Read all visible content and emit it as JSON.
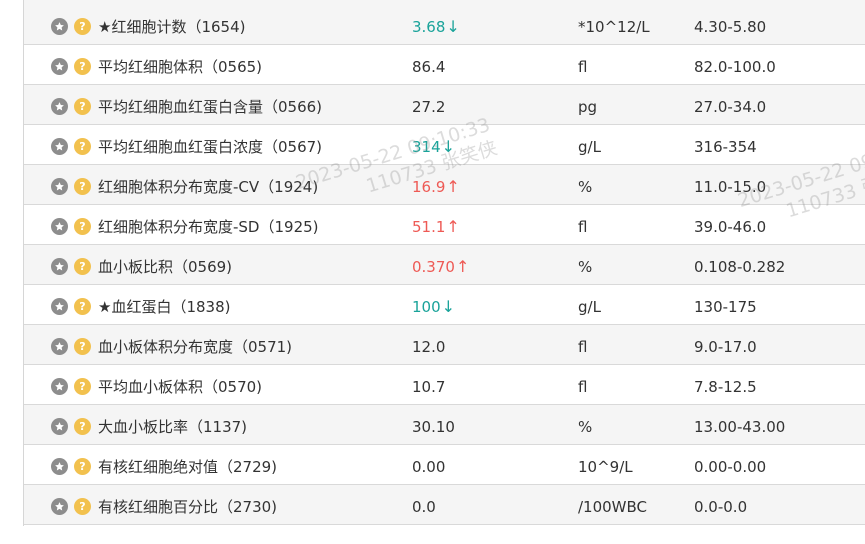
{
  "results_table": {
    "rows": [
      {
        "name": "★红细胞计数（1654)",
        "result": "3.68",
        "flag": "low",
        "arrow": "↓",
        "unit": "*10^12/L",
        "range": "4.30-5.80"
      },
      {
        "name": "平均红细胞体积（0565)",
        "result": "86.4",
        "flag": "",
        "arrow": "",
        "unit": "fl",
        "range": "82.0-100.0"
      },
      {
        "name": "平均红细胞血红蛋白含量（0566)",
        "result": "27.2",
        "flag": "",
        "arrow": "",
        "unit": "pg",
        "range": "27.0-34.0"
      },
      {
        "name": "平均红细胞血红蛋白浓度（0567)",
        "result": "314",
        "flag": "low",
        "arrow": "↓",
        "unit": "g/L",
        "range": "316-354"
      },
      {
        "name": "红细胞体积分布宽度-CV（1924)",
        "result": "16.9",
        "flag": "high",
        "arrow": "↑",
        "unit": "%",
        "range": "11.0-15.0"
      },
      {
        "name": "红细胞体积分布宽度-SD（1925)",
        "result": "51.1",
        "flag": "high",
        "arrow": "↑",
        "unit": "fl",
        "range": "39.0-46.0"
      },
      {
        "name": "血小板比积（0569)",
        "result": "0.370",
        "flag": "high",
        "arrow": "↑",
        "unit": "%",
        "range": "0.108-0.282"
      },
      {
        "name": "★血红蛋白（1838)",
        "result": "100",
        "flag": "low",
        "arrow": "↓",
        "unit": "g/L",
        "range": "130-175"
      },
      {
        "name": "血小板体积分布宽度（0571)",
        "result": "12.0",
        "flag": "",
        "arrow": "",
        "unit": "fl",
        "range": "9.0-17.0"
      },
      {
        "name": "平均血小板体积（0570)",
        "result": "10.7",
        "flag": "",
        "arrow": "",
        "unit": "fl",
        "range": "7.8-12.5"
      },
      {
        "name": "大血小板比率（1137)",
        "result": "30.10",
        "flag": "",
        "arrow": "",
        "unit": "%",
        "range": "13.00-43.00"
      },
      {
        "name": "有核红细胞绝对值（2729)",
        "result": "0.00",
        "flag": "",
        "arrow": "",
        "unit": "10^9/L",
        "range": "0.00-0.00"
      },
      {
        "name": "有核红细胞百分比（2730)",
        "result": "0.0",
        "flag": "",
        "arrow": "",
        "unit": "/100WBC",
        "range": "0.0-0.0"
      }
    ]
  },
  "watermarks": [
    {
      "line1": "2023-05-22 09:10:33",
      "line2": "110733 张笑侠"
    },
    {
      "line1": "2023-05-22 09",
      "line2": "110733 张"
    }
  ],
  "icons": {
    "favorite": "star-icon",
    "help": "question-icon",
    "help_glyph": "?"
  },
  "colors": {
    "low": "#1aa39a",
    "high": "#ee5a55",
    "star_button": "#8d8d8d",
    "help_button": "#f2c14e"
  }
}
